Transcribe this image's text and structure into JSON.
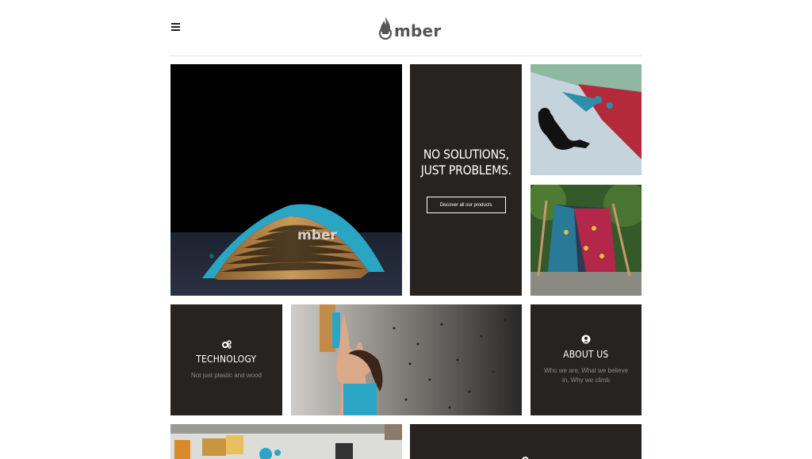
{
  "brand": {
    "logo_text": "mber"
  },
  "header": {
    "menu_icon": "hamburger-menu-icon"
  },
  "hero": {
    "product_logo_text": "mber"
  },
  "promo": {
    "title": "NO SOLUTIONS,\nJUST PROBLEMS.",
    "button_label": "Discover all our products"
  },
  "technology": {
    "icon": "gears-icon",
    "title": "TECHNOLOGY",
    "subtitle": "Not just plastic and wood"
  },
  "about": {
    "icon": "user-circle-icon",
    "title": "ABOUT US",
    "subtitle": "Who we are, What we believe in, Why we climb"
  },
  "colors": {
    "tile_dark": "#272320",
    "accent_teal": "#2aa5c4",
    "wood": "#b98a4e"
  }
}
